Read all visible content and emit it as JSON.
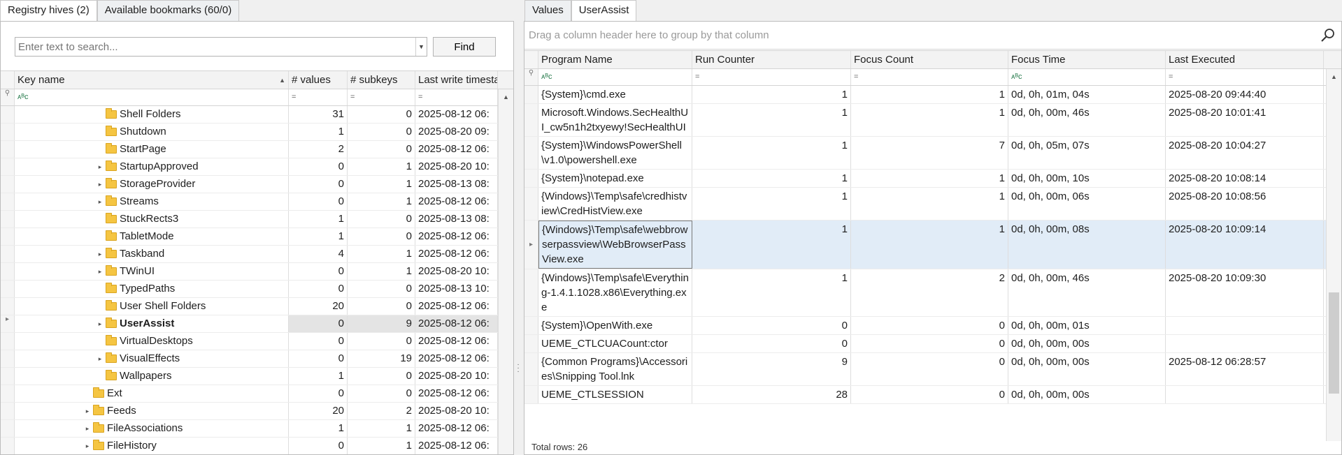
{
  "left_tabs": [
    {
      "label": "Registry hives (2)"
    },
    {
      "label": "Available bookmarks (60/0)"
    }
  ],
  "right_tabs": [
    {
      "label": "Values"
    },
    {
      "label": "UserAssist"
    }
  ],
  "search": {
    "placeholder": "Enter text to search...",
    "find_label": "Find"
  },
  "left_grid": {
    "headers": {
      "key": "Key name",
      "values": "# values",
      "subkeys": "# subkeys",
      "time": "Last write timestar"
    },
    "filter_symbols": {
      "text": "ᴀᴮc",
      "eq": "="
    },
    "rows": [
      {
        "name": "Shell Folders",
        "values": "31",
        "subkeys": "0",
        "time": "2025-08-12 06:"
      },
      {
        "name": "Shutdown",
        "values": "1",
        "subkeys": "0",
        "time": "2025-08-20 09:"
      },
      {
        "name": "StartPage",
        "values": "2",
        "subkeys": "0",
        "time": "2025-08-12 06:"
      },
      {
        "name": "StartupApproved",
        "values": "0",
        "subkeys": "1",
        "time": "2025-08-20 10:"
      },
      {
        "name": "StorageProvider",
        "values": "0",
        "subkeys": "1",
        "time": "2025-08-13 08:"
      },
      {
        "name": "Streams",
        "values": "0",
        "subkeys": "1",
        "time": "2025-08-12 06:"
      },
      {
        "name": "StuckRects3",
        "values": "1",
        "subkeys": "0",
        "time": "2025-08-13 08:"
      },
      {
        "name": "TabletMode",
        "values": "1",
        "subkeys": "0",
        "time": "2025-08-12 06:"
      },
      {
        "name": "Taskband",
        "values": "4",
        "subkeys": "1",
        "time": "2025-08-12 06:"
      },
      {
        "name": "TWinUI",
        "values": "0",
        "subkeys": "1",
        "time": "2025-08-20 10:"
      },
      {
        "name": "TypedPaths",
        "values": "0",
        "subkeys": "0",
        "time": "2025-08-13 10:"
      },
      {
        "name": "User Shell Folders",
        "values": "20",
        "subkeys": "0",
        "time": "2025-08-12 06:"
      },
      {
        "name": "UserAssist",
        "values": "0",
        "subkeys": "9",
        "time": "2025-08-12 06:"
      },
      {
        "name": "VirtualDesktops",
        "values": "0",
        "subkeys": "0",
        "time": "2025-08-12 06:"
      },
      {
        "name": "VisualEffects",
        "values": "0",
        "subkeys": "19",
        "time": "2025-08-12 06:"
      },
      {
        "name": "Wallpapers",
        "values": "1",
        "subkeys": "0",
        "time": "2025-08-20 10:"
      },
      {
        "name": "Ext",
        "values": "0",
        "subkeys": "0",
        "time": "2025-08-12 06:"
      },
      {
        "name": "Feeds",
        "values": "20",
        "subkeys": "2",
        "time": "2025-08-20 10:"
      },
      {
        "name": "FileAssociations",
        "values": "1",
        "subkeys": "1",
        "time": "2025-08-12 06:"
      },
      {
        "name": "FileHistory",
        "values": "0",
        "subkeys": "1",
        "time": "2025-08-12 06:"
      }
    ]
  },
  "right_grid": {
    "group_hint": "Drag a column header here to group by that column",
    "headers": {
      "name": "Program Name",
      "run": "Run Counter",
      "focus": "Focus Count",
      "ftime": "Focus Time",
      "last": "Last Executed"
    },
    "rows": [
      {
        "name": "{System}\\cmd.exe",
        "run": "1",
        "focus": "1",
        "ftime": "0d, 0h, 01m, 04s",
        "last": "2025-08-20 09:44:40"
      },
      {
        "name": "Microsoft.Windows.SecHealthUI_cw5n1h2txyewy!SecHealthUI",
        "run": "1",
        "focus": "1",
        "ftime": "0d, 0h, 00m, 46s",
        "last": "2025-08-20 10:01:41"
      },
      {
        "name": "{System}\\WindowsPowerShell\\v1.0\\powershell.exe",
        "run": "1",
        "focus": "7",
        "ftime": "0d, 0h, 05m, 07s",
        "last": "2025-08-20 10:04:27"
      },
      {
        "name": "{System}\\notepad.exe",
        "run": "1",
        "focus": "1",
        "ftime": "0d, 0h, 00m, 10s",
        "last": "2025-08-20 10:08:14"
      },
      {
        "name": "{Windows}\\Temp\\safe\\credhistview\\CredHistView.exe",
        "run": "1",
        "focus": "1",
        "ftime": "0d, 0h, 00m, 06s",
        "last": "2025-08-20 10:08:56"
      },
      {
        "name": "{Windows}\\Temp\\safe\\webbrowserpassview\\WebBrowserPassView.exe",
        "run": "1",
        "focus": "1",
        "ftime": "0d, 0h, 00m, 08s",
        "last": "2025-08-20 10:09:14"
      },
      {
        "name": "{Windows}\\Temp\\safe\\Everything-1.4.1.1028.x86\\Everything.exe",
        "run": "1",
        "focus": "2",
        "ftime": "0d, 0h, 00m, 46s",
        "last": "2025-08-20 10:09:30"
      },
      {
        "name": "{System}\\OpenWith.exe",
        "run": "0",
        "focus": "0",
        "ftime": "0d, 0h, 00m, 01s",
        "last": ""
      },
      {
        "name": "UEME_CTLCUACount:ctor",
        "run": "0",
        "focus": "0",
        "ftime": "0d, 0h, 00m, 00s",
        "last": ""
      },
      {
        "name": "{Common Programs}\\Accessories\\Snipping Tool.lnk",
        "run": "9",
        "focus": "0",
        "ftime": "0d, 0h, 00m, 00s",
        "last": "2025-08-12 06:28:57"
      },
      {
        "name": "UEME_CTLSESSION",
        "run": "28",
        "focus": "0",
        "ftime": "0d, 0h, 00m, 00s",
        "last": ""
      }
    ]
  },
  "status": {
    "total_label": "Total rows: 26"
  },
  "icons": {
    "folder": "folder-icon",
    "search": "magnifier-icon",
    "expand": "chevron-right-icon",
    "sort": "sort-up-icon",
    "filter": "filter-icon"
  },
  "colors": {
    "selected_row": "#e1ecf7",
    "folder": "#f5c542",
    "focus_row_indicator": "#e4e4e4"
  }
}
